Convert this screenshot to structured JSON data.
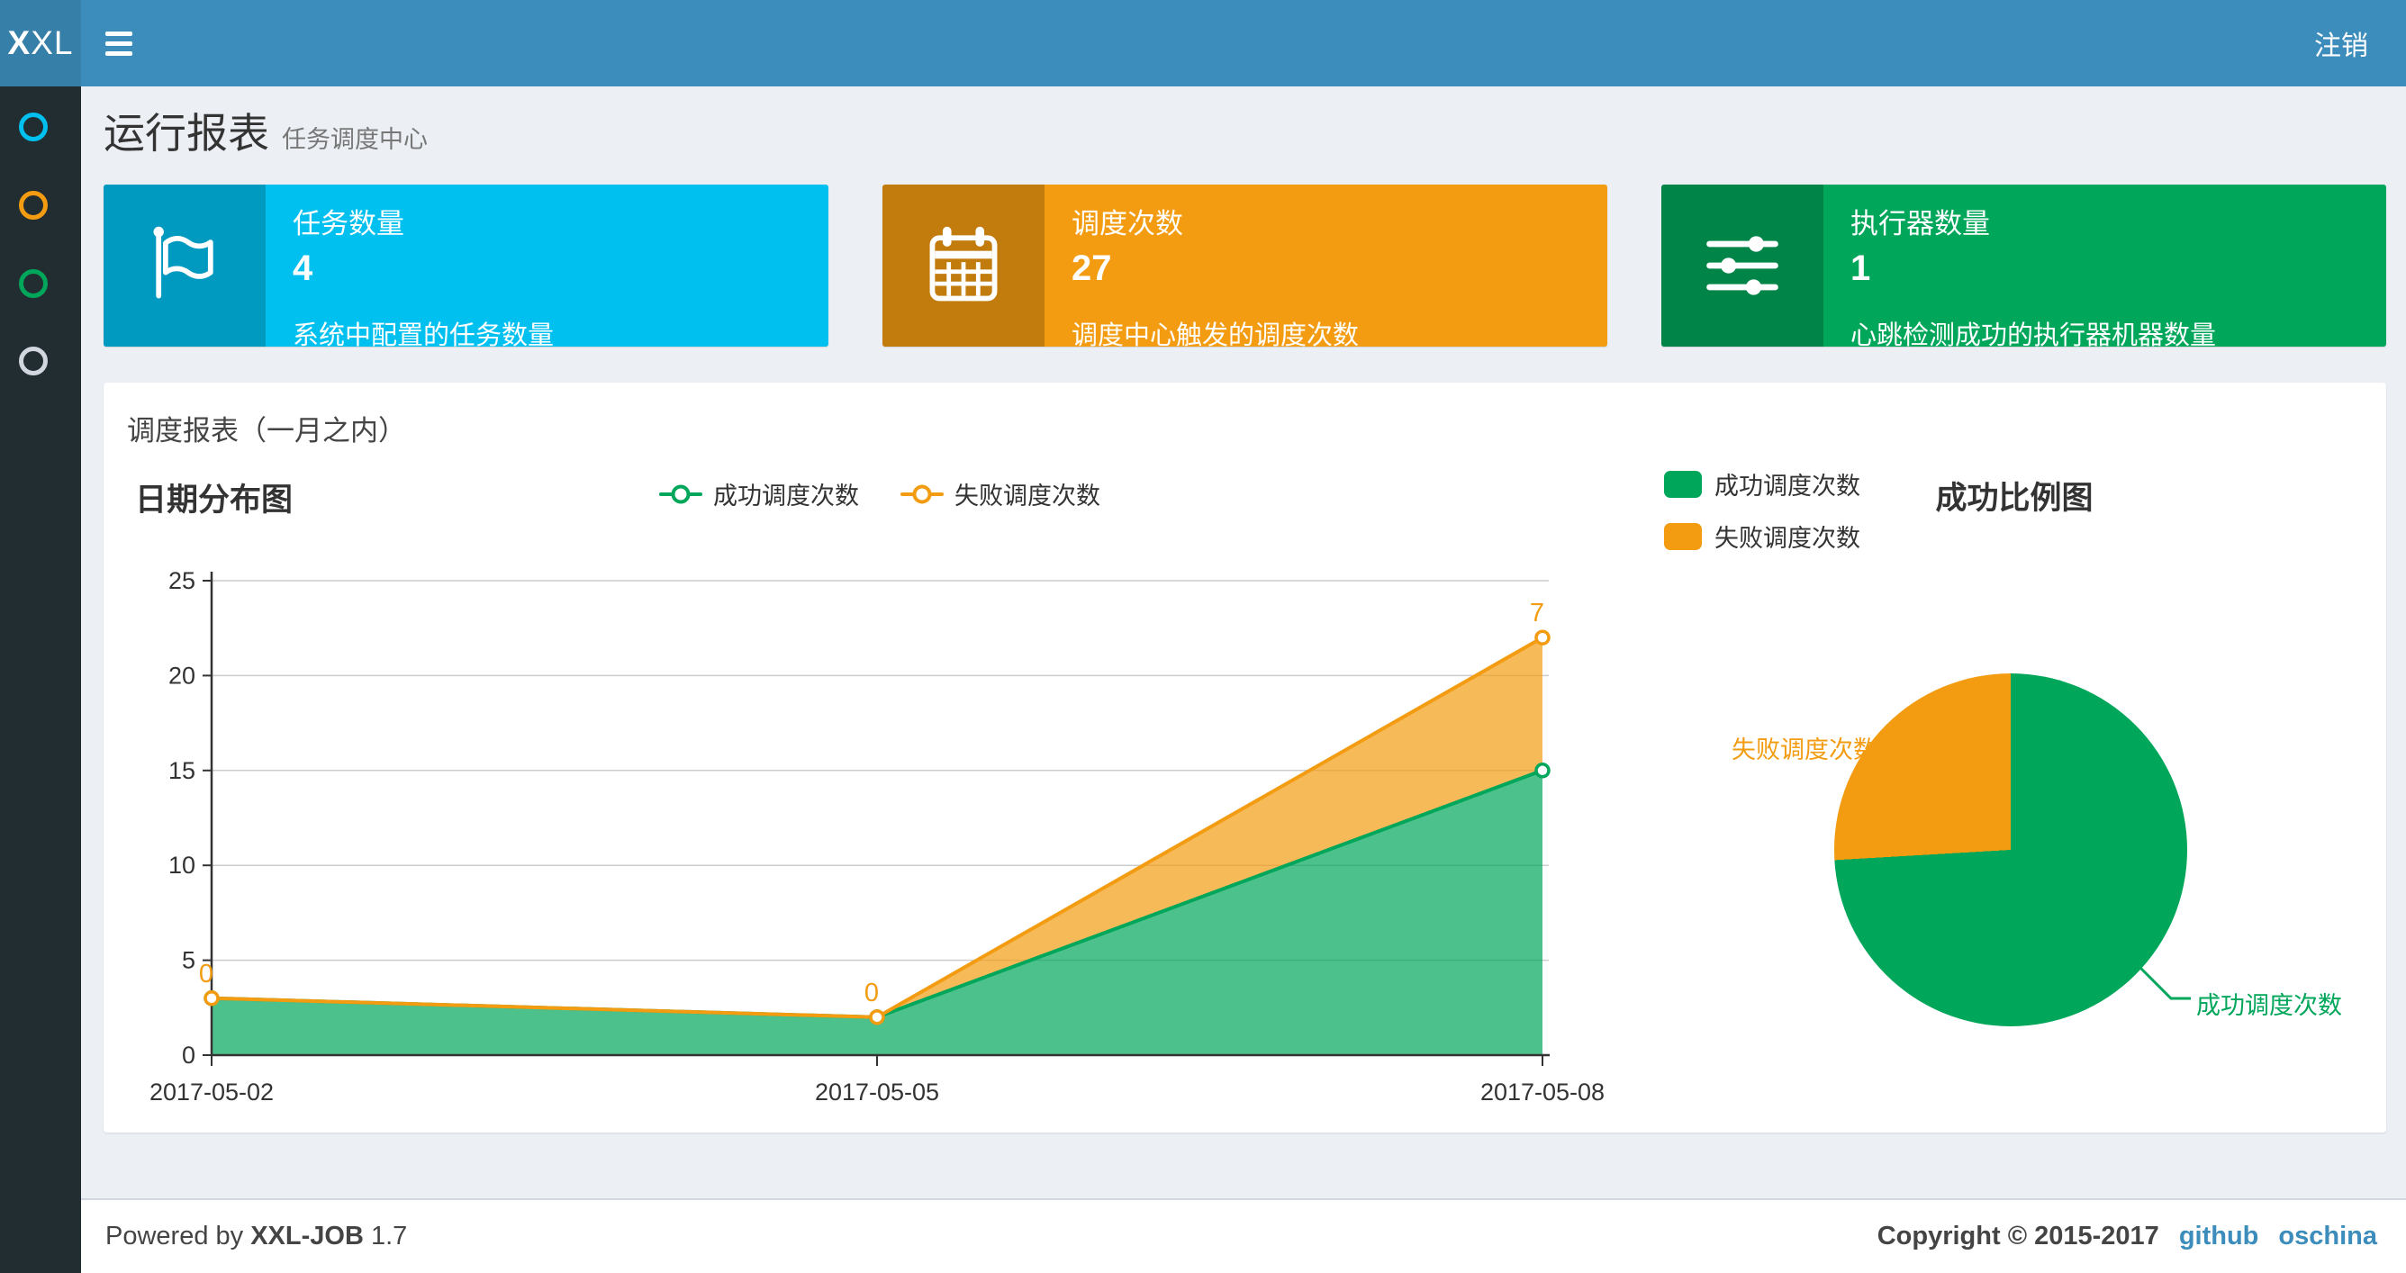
{
  "navbar": {
    "logo_bold": "X",
    "logo_rest": "XL",
    "logout_label": "注销"
  },
  "sidebar": {
    "items": [
      {
        "icon": "circle-icon",
        "color": "#00c0ef"
      },
      {
        "icon": "circle-icon",
        "color": "#f39c12"
      },
      {
        "icon": "circle-icon",
        "color": "#00a65a"
      },
      {
        "icon": "circle-icon",
        "color": "#d2d6de"
      }
    ]
  },
  "header": {
    "title": "运行报表",
    "subtitle": "任务调度中心"
  },
  "stat_cards": [
    {
      "label": "任务数量",
      "value": "4",
      "description": "系统中配置的任务数量",
      "color": "#00c0ef",
      "icon": "flag-icon"
    },
    {
      "label": "调度次数",
      "value": "27",
      "description": "调度中心触发的调度次数",
      "color": "#f39c12",
      "icon": "calendar-icon"
    },
    {
      "label": "执行器数量",
      "value": "1",
      "description": "心跳检测成功的执行器机器数量",
      "color": "#00a65a",
      "icon": "sliders-icon"
    }
  ],
  "panel": {
    "title": "调度报表（一月之内）"
  },
  "chart_data": [
    {
      "type": "area",
      "title": "日期分布图",
      "categories": [
        "2017-05-02",
        "2017-05-05",
        "2017-05-08"
      ],
      "series": [
        {
          "name": "成功调度次数",
          "color": "#00A65A",
          "values": [
            3,
            2,
            15
          ]
        },
        {
          "name": "失败调度次数",
          "color": "#F39C12",
          "values": [
            0,
            0,
            7
          ]
        }
      ],
      "stacked": true,
      "ylim": [
        0,
        25
      ],
      "yticks": [
        0,
        5,
        10,
        15,
        20,
        25
      ],
      "point_labels": {
        "series": "失败调度次数",
        "values": [
          "0",
          "0",
          "7"
        ]
      },
      "legend_position": "top-center",
      "grid": true
    },
    {
      "type": "pie",
      "title": "成功比例图",
      "slices": [
        {
          "label": "成功调度次数",
          "value": 20,
          "color": "#00A65A"
        },
        {
          "label": "失败调度次数",
          "value": 7,
          "color": "#F39C12"
        }
      ],
      "start_angle": "top",
      "direction": "clockwise",
      "legend_position": "top-left"
    }
  ],
  "footer": {
    "powered_prefix": "Powered by",
    "brand": "XXL-JOB",
    "version": "1.7",
    "copyright": "Copyright © 2015-2017",
    "links": [
      {
        "label": "github"
      },
      {
        "label": "oschina"
      }
    ]
  },
  "colors": {
    "navbar": "#3c8dbc",
    "logo_bg": "#367fa9",
    "sidebar_bg": "#222d32",
    "content_bg": "#ecf0f5",
    "link": "#3c8dbc"
  }
}
